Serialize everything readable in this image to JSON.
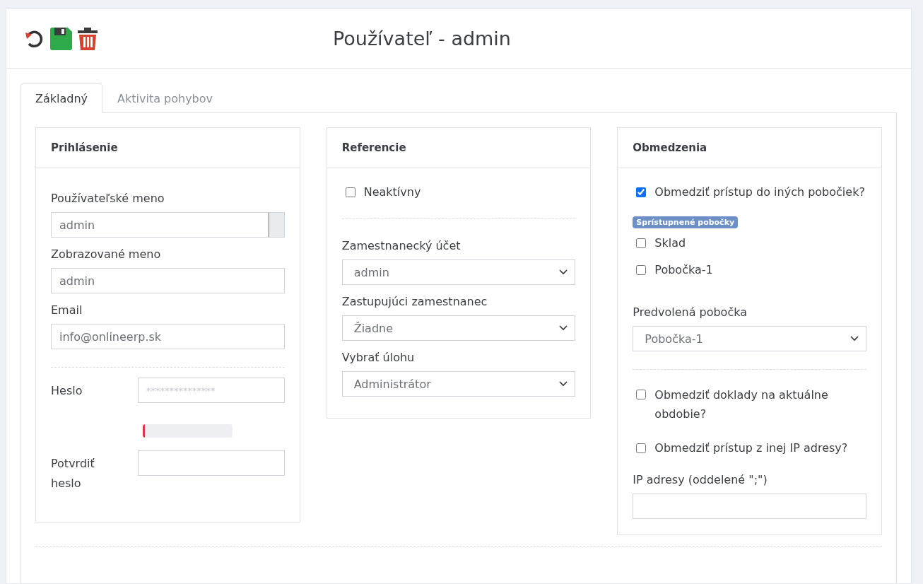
{
  "header": {
    "title": "Používateľ - admin"
  },
  "tabs": [
    {
      "label": "Základný",
      "selected": true
    },
    {
      "label": "Aktivita pohybov",
      "selected": false
    }
  ],
  "login": {
    "title": "Prihlásenie",
    "username": {
      "label": "Používateľské meno",
      "value": "admin"
    },
    "display_name": {
      "label": "Zobrazované meno",
      "value": "admin"
    },
    "email": {
      "label": "Email",
      "value": "info@onlineerp.sk"
    },
    "password": {
      "label": "Heslo",
      "placeholder": "***************",
      "strength": {
        "level": 0.02
      }
    },
    "confirm": {
      "label": "Potvrdiť heslo"
    }
  },
  "references": {
    "title": "Referencie",
    "inactive": {
      "label": "Neaktívny",
      "checked": false
    },
    "selects": [
      {
        "label": "Zamestnanecký účet",
        "value": "admin"
      },
      {
        "label": "Zastupujúci zamestnanec",
        "value": "Žiadne"
      },
      {
        "label": "Vybrať úlohu",
        "value": "Administrátor"
      }
    ]
  },
  "restrictions": {
    "title": "Obmedzenia",
    "restrict_branches": {
      "label": "Obmedziť prístup do iných pobočiek?",
      "checked": true
    },
    "badge": "Sprístupnené pobočky",
    "branches": [
      {
        "label": "Sklad",
        "checked": false
      },
      {
        "label": "Pobočka-1",
        "checked": false
      }
    ],
    "default_branch": {
      "label": "Predvolená pobočka",
      "value": "Pobočka-1"
    },
    "restrict_documents": {
      "label": "Obmedziť doklady na aktuálne obdobie?",
      "checked": false
    },
    "restrict_ip": {
      "label": "Obmedziť prístup z inej IP adresy?",
      "checked": false
    },
    "ip": {
      "label": "IP adresy (oddelené \";\")"
    }
  }
}
